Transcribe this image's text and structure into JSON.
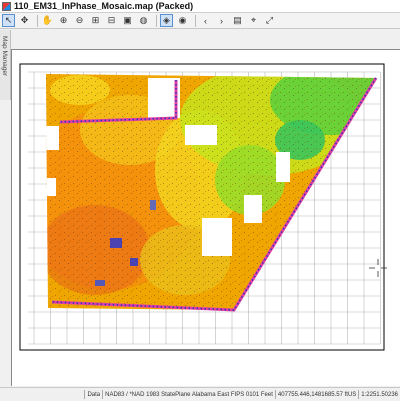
{
  "window": {
    "title": "110_EM31_InPhase_Mosaic.map (Packed)"
  },
  "toolbar": {
    "buttons": [
      {
        "name": "select-tool-button",
        "glyph": "↖",
        "active": true
      },
      {
        "name": "move-tool-button",
        "glyph": "✥",
        "active": false
      },
      {
        "name": "pan-tool-button",
        "glyph": "✋",
        "active": false
      },
      {
        "name": "zoom-in-button",
        "glyph": "⊕",
        "active": false
      },
      {
        "name": "zoom-out-button",
        "glyph": "⊖",
        "active": false
      },
      {
        "name": "fixed-zoom-in-button",
        "glyph": "⊞",
        "active": false
      },
      {
        "name": "fixed-zoom-out-button",
        "glyph": "⊟",
        "active": false
      },
      {
        "name": "full-extent-button",
        "glyph": "▣",
        "active": false
      },
      {
        "name": "globe-button",
        "glyph": "◍",
        "active": false
      },
      {
        "name": "layer-button",
        "glyph": "◈",
        "active": true
      },
      {
        "name": "image-button",
        "glyph": "◉",
        "active": false
      },
      {
        "name": "back-button",
        "glyph": "‹",
        "active": false
      },
      {
        "name": "forward-button",
        "glyph": "›",
        "active": false
      },
      {
        "name": "bookmark-button",
        "glyph": "▤",
        "active": false
      },
      {
        "name": "measure-button",
        "glyph": "⌖",
        "active": false
      },
      {
        "name": "go-to-button",
        "glyph": "⤢",
        "active": false
      }
    ]
  },
  "side_panel": {
    "label": "Map Manager"
  },
  "status": {
    "layer": "Data",
    "projection": "NAD83 / *NAD 1983 StatePlane Alabama East FIPS 0101 Feet",
    "coords": "407755.446,1481685.57 ftUS",
    "scale": "1:2251.50236"
  },
  "colors": {
    "accent": "#5a8fd0",
    "survey_line": "#e040a0",
    "survey_dots": "#3030c0"
  }
}
